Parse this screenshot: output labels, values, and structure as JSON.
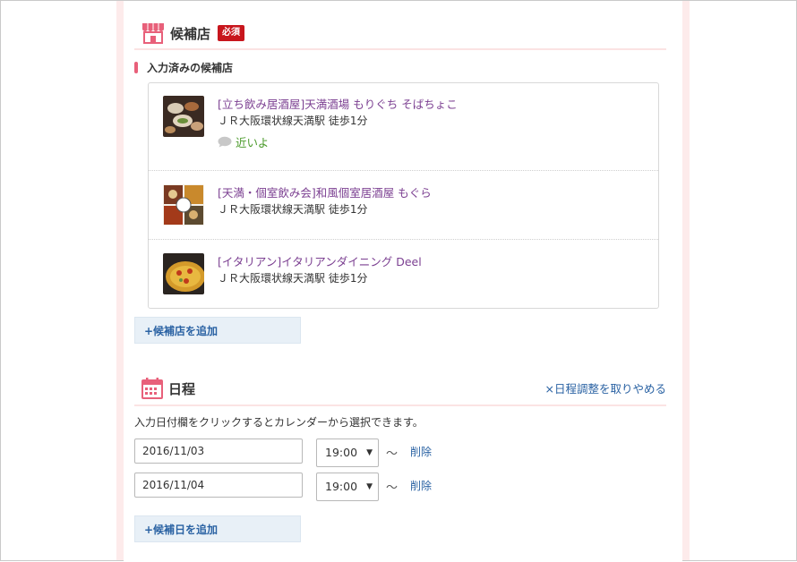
{
  "shops_section": {
    "title": "候補店",
    "required_badge": "必須",
    "entered_label": "入力済みの候補店",
    "shops": [
      {
        "name": "[立ち飲み居酒屋]天満酒場 もりぐち そばちょこ",
        "station": "ＪＲ大阪環状線天満駅 徒歩1分",
        "comment": "近いよ"
      },
      {
        "name": "[天満・個室飲み会]和風個室居酒屋 もぐら",
        "station": "ＪＲ大阪環状線天満駅 徒歩1分"
      },
      {
        "name": "[イタリアン]イタリアンダイニング Deel",
        "station": "ＪＲ大阪環状線天満駅 徒歩1分"
      }
    ],
    "add_label": "+候補店を追加"
  },
  "schedule_section": {
    "title": "日程",
    "cancel_link": "×日程調整を取りやめる",
    "note": "入力日付欄をクリックするとカレンダーから選択できます。",
    "dates": [
      {
        "date": "2016/11/03",
        "time": "19:00",
        "tilde": "～",
        "delete": "削除"
      },
      {
        "date": "2016/11/04",
        "time": "19:00",
        "tilde": "～",
        "delete": "削除"
      }
    ],
    "add_label": "+候補日を追加"
  },
  "icons": {
    "shop_icon": "shop-icon",
    "calendar_icon": "calendar-icon",
    "comment_icon": "speech-bubble-icon",
    "dropdown_icon": "triangle-down-icon"
  },
  "colors": {
    "accent_pink": "#e8607a",
    "required_red": "#c8161d",
    "link_blue": "#2a62a3",
    "shop_name_purple": "#7b3f91",
    "comment_green": "#4a9a2a",
    "button_bg": "#e8f0f7"
  }
}
